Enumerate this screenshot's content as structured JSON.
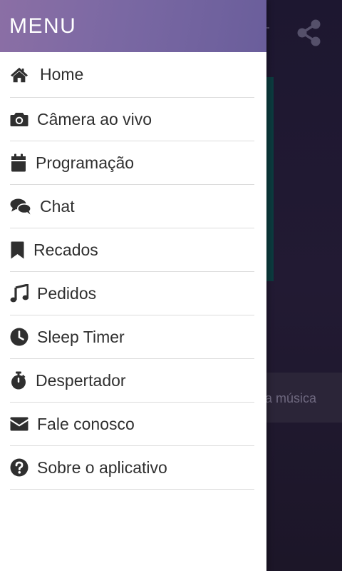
{
  "background": {
    "search_placeholder": "a música"
  },
  "drawer": {
    "title": "MENU",
    "items": [
      {
        "label": "Home",
        "icon": "home-icon"
      },
      {
        "label": "Câmera ao vivo",
        "icon": "camera-icon"
      },
      {
        "label": "Programação",
        "icon": "calendar-icon"
      },
      {
        "label": "Chat",
        "icon": "chat-icon"
      },
      {
        "label": "Recados",
        "icon": "bookmark-icon"
      },
      {
        "label": "Pedidos",
        "icon": "music-icon"
      },
      {
        "label": "Sleep Timer",
        "icon": "clock-icon"
      },
      {
        "label": "Despertador",
        "icon": "stopwatch-icon"
      },
      {
        "label": "Fale conosco",
        "icon": "envelope-icon"
      },
      {
        "label": "Sobre o aplicativo",
        "icon": "question-circle-icon"
      }
    ]
  },
  "colors": {
    "header_start": "#8b6fa5",
    "header_end": "#6a5e9b",
    "text": "#2f2f2f",
    "divider": "#dcdcdc"
  }
}
